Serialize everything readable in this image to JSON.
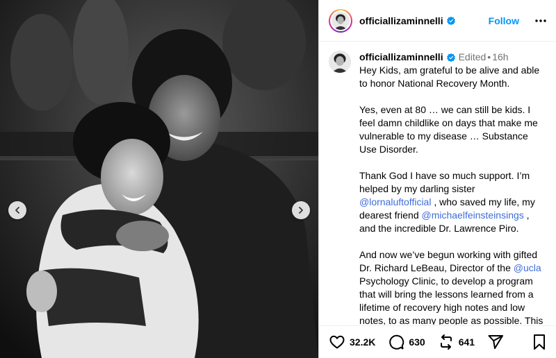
{
  "post": {
    "username": "officiallizaminnelli",
    "verified": true,
    "follow_label": "Follow",
    "more_icon": "more-horizontal-icon",
    "photo": {
      "description_icon": "photo-carousel",
      "prev_icon": "chevron-left-icon",
      "next_icon": "chevron-right-icon"
    }
  },
  "caption": {
    "username": "officiallizaminnelli",
    "edited": "Edited",
    "separator": "•",
    "time": "16h",
    "p1": "Hey Kids, am grateful to be alive and able to honor National Recovery Month.",
    "p2": "Yes, even at 80 … we can still be kids. I feel damn childlike on days that make me vulnerable to my disease … Substance Use Disorder.",
    "p3a": "Thank God I have so much support. I’m helped by my darling sister ",
    "p3_mention1": "@lornaluftofficial",
    "p3b": " , who saved my life, my dearest friend ",
    "p3_mention2": "@michaelfeinsteinsings",
    "p3c": " , and the incredible Dr. Lawrence Piro.",
    "p4a": "And now we’ve begun working with gifted Dr. Richard LeBeau, Director of the ",
    "p4_mention": "@ucla",
    "p4b": " Psychology Clinic, to develop a program that will bring the lessons learned from a lifetime of recovery high notes and low notes, to as many people as possible. This will be a companion to"
  },
  "actions": {
    "likes": "32.2K",
    "comments": "630",
    "reposts": "641",
    "like_icon": "heart-icon",
    "comment_icon": "comment-icon",
    "repost_icon": "repost-icon",
    "share_icon": "share-icon",
    "save_icon": "bookmark-icon"
  },
  "colors": {
    "link": "#0095f6",
    "mention": "#3f6cd8",
    "muted": "#737373",
    "verified": "#0095f6"
  }
}
